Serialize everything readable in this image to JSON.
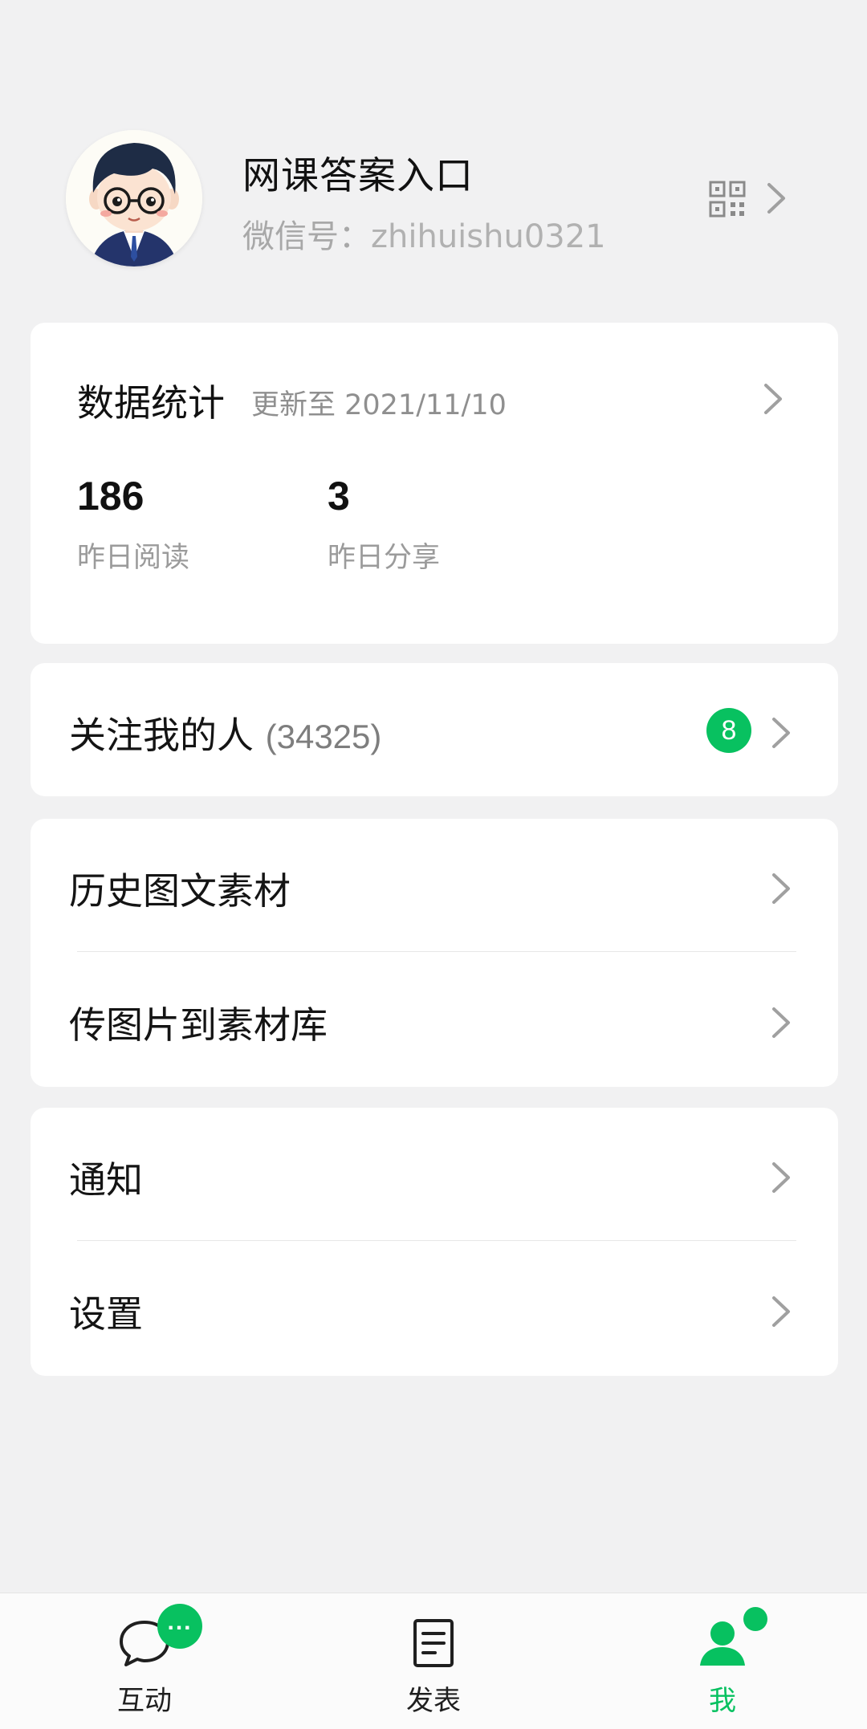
{
  "profile": {
    "name": "网课答案入口",
    "wechat_label": "微信号：",
    "wechat_id": "zhihuishu0321",
    "qr_icon": "qr-code-icon",
    "arrow_icon": "chevron-right-icon"
  },
  "stats": {
    "title": "数据统计",
    "update_text": "更新至 2021/11/10",
    "items": [
      {
        "value": "186",
        "label": "昨日阅读"
      },
      {
        "value": "3",
        "label": "昨日分享"
      }
    ]
  },
  "followers": {
    "label": "关注我的人",
    "count": "(34325)",
    "badge": "8"
  },
  "materials": {
    "items": [
      {
        "label": "历史图文素材"
      },
      {
        "label": "传图片到素材库"
      }
    ]
  },
  "misc": {
    "items": [
      {
        "label": "通知"
      },
      {
        "label": "设置"
      }
    ]
  },
  "tabbar": {
    "tabs": [
      {
        "label": "互动",
        "icon": "chat-bubble-icon",
        "badge": "..."
      },
      {
        "label": "发表",
        "icon": "document-icon"
      },
      {
        "label": "我",
        "icon": "person-icon",
        "active": true
      }
    ]
  },
  "colors": {
    "accent": "#07c160",
    "background": "#f1f1f2",
    "card": "#ffffff",
    "secondary_text": "#9b9b9b"
  }
}
